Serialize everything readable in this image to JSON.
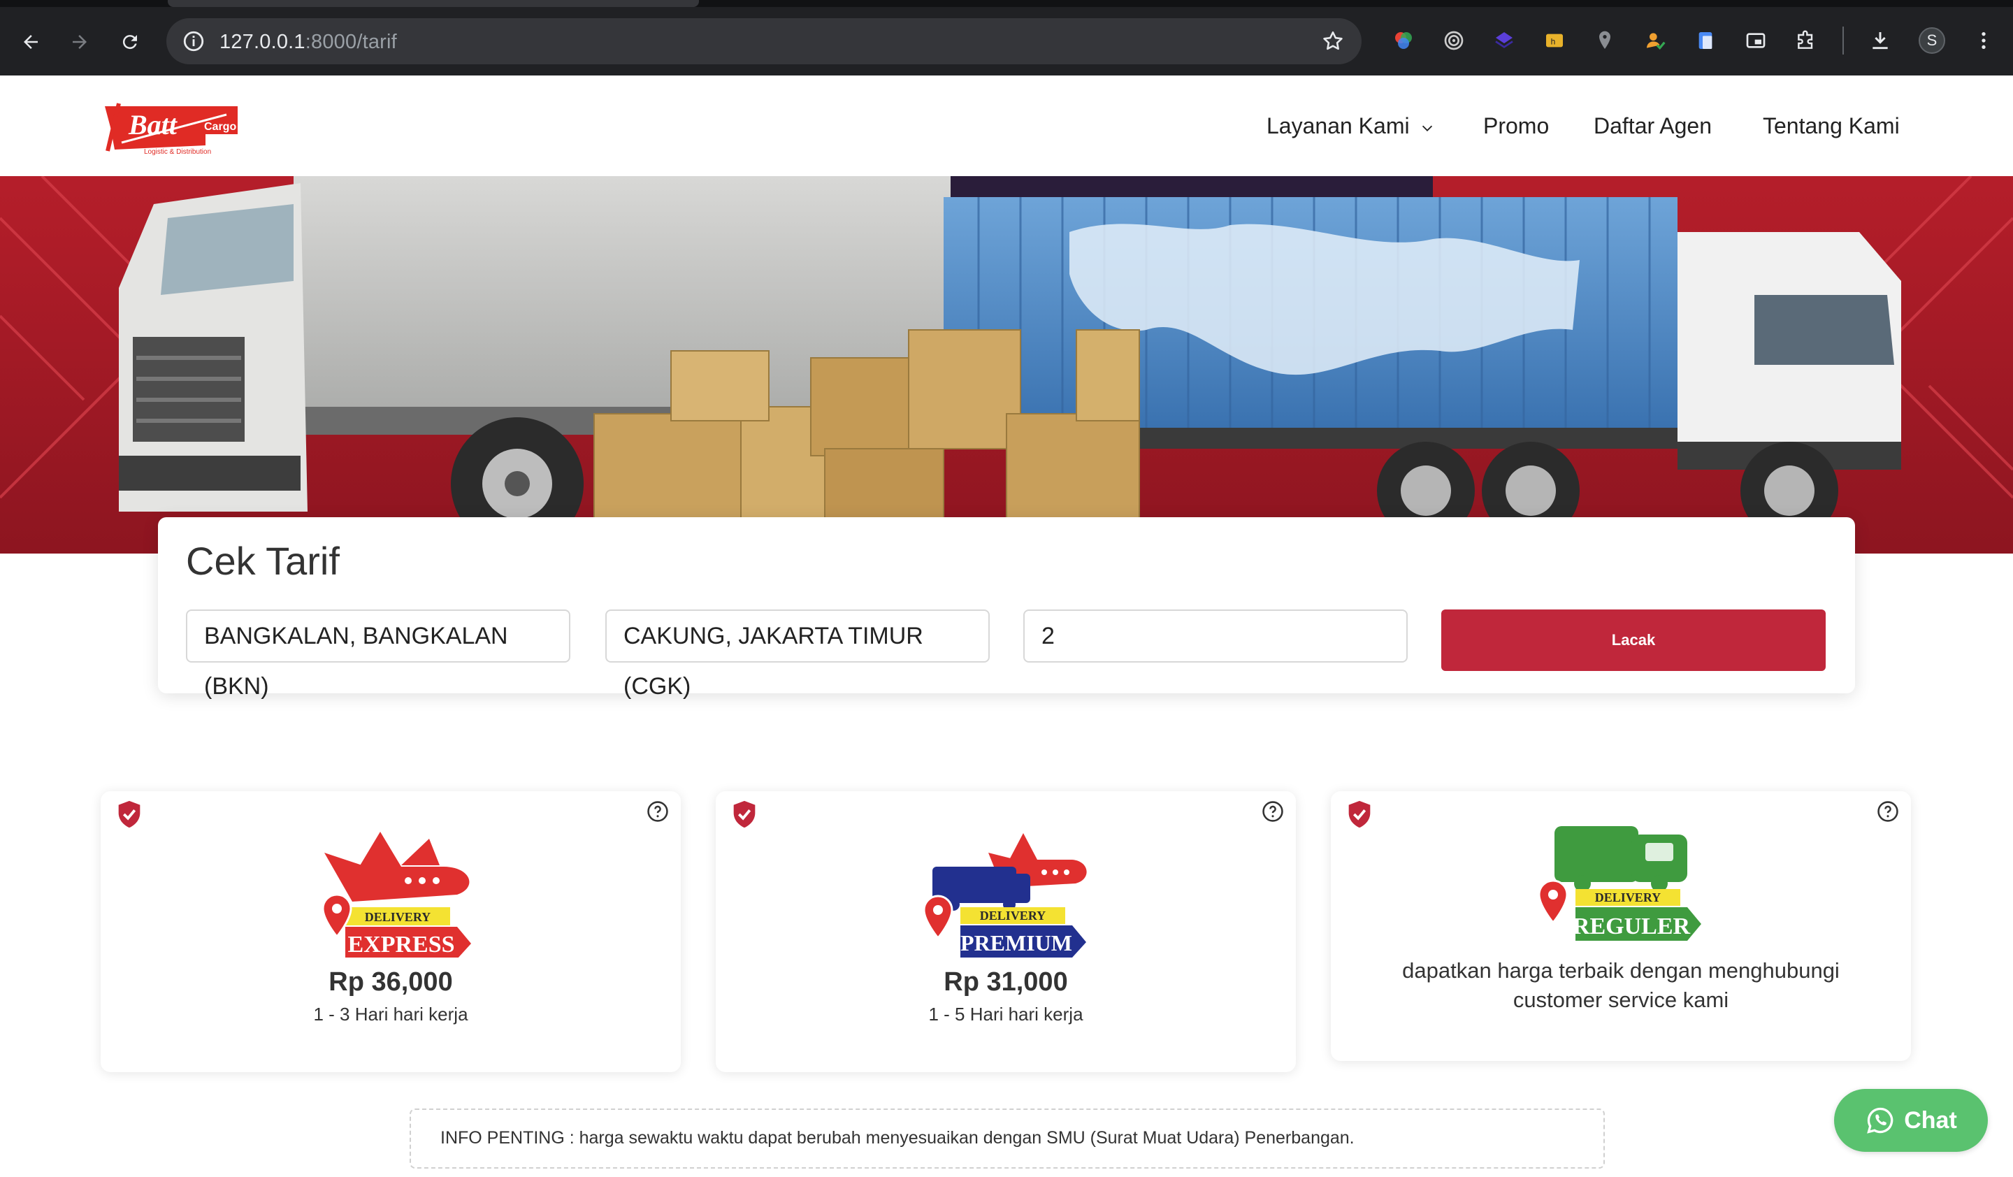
{
  "browser": {
    "url_host": "127.0.0.1",
    "url_path": ":8000/tarif",
    "profile_initial": "S"
  },
  "nav": {
    "items": [
      {
        "label": "Layanan Kami"
      },
      {
        "label": "Promo"
      },
      {
        "label": "Daftar Agen"
      },
      {
        "label": "Tentang Kami"
      }
    ]
  },
  "logo": {
    "text": "Batt",
    "sub": "Cargo",
    "tagline": "Logistic & Distribution"
  },
  "tarif": {
    "title": "Cek Tarif",
    "origin": "BANGKALAN, BANGKALAN (BKN)",
    "destination": "CAKUNG, JAKARTA TIMUR (CGK)",
    "weight": "2",
    "button": "Lacak"
  },
  "services": [
    {
      "badge_top": "DELIVERY",
      "badge_name": "EXPRESS",
      "price": "Rp 36,000",
      "eta": "1 - 3 Hari hari kerja",
      "color": "#e0302f"
    },
    {
      "badge_top": "DELIVERY",
      "badge_name": "PREMIUM",
      "price": "Rp 31,000",
      "eta": "1 - 5 Hari hari kerja",
      "color": "#22308f"
    },
    {
      "badge_top": "DELIVERY",
      "badge_name": "REGULER",
      "note": "dapatkan harga terbaik dengan menghubungi customer service kami",
      "color": "#3f9b3f"
    }
  ],
  "info": {
    "text": "INFO PENTING : harga sewaktu waktu dapat berubah menyesuaikan dengan SMU (Surat Muat Udara) Penerbangan."
  },
  "chat": {
    "label": "Chat"
  },
  "colors": {
    "brand_red": "#c0273b",
    "whatsapp_green": "#5ac26f"
  }
}
